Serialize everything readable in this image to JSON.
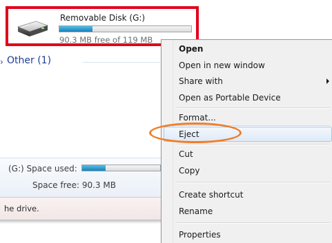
{
  "drive": {
    "name": "Removable Disk (G:)",
    "free_text": "90.3 MB free of 119 MB",
    "used_fraction": 0.25
  },
  "group": {
    "label": "Other (1)",
    "marker": "›"
  },
  "details": {
    "used_label": "(G:)  Space used:",
    "free_label": "Space free:  90.3 MB",
    "used_fraction": 0.3
  },
  "status": {
    "text": "he drive."
  },
  "context_menu": {
    "items": {
      "open": "Open",
      "open_new_window": "Open in new window",
      "share_with": "Share with",
      "open_portable": "Open as Portable Device",
      "format": "Format...",
      "eject": "Eject",
      "cut": "Cut",
      "copy": "Copy",
      "create_shortcut": "Create shortcut",
      "rename": "Rename",
      "properties": "Properties"
    }
  },
  "colors": {
    "highlight_box": "#e2001a",
    "annotation_ring": "#f07d28",
    "bar_fill": "#1c7fb8",
    "group_text": "#1e3c96"
  },
  "icons": {
    "drive": "usb-drive-icon",
    "submenu": "chevron-right-icon"
  }
}
